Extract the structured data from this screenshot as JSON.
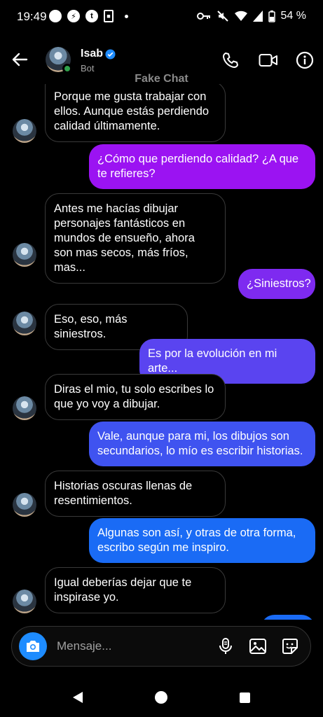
{
  "status_bar": {
    "time": "19:49",
    "battery": "54 %"
  },
  "header": {
    "back_icon": "arrow-left-icon",
    "name": "Isab",
    "subtitle": "Bot",
    "verified_icon": "verified-badge-icon",
    "call_icon": "phone-icon",
    "video_icon": "video-camera-icon",
    "info_icon": "info-icon"
  },
  "watermark": "Fake Chat",
  "messages": [
    {
      "from": "them",
      "text": "Porque me gusta trabajar con ellos. Aunque estás perdiendo calidad últimamente."
    },
    {
      "from": "me",
      "text": "¿Cómo que perdiendo calidad? ¿A que te refieres?"
    },
    {
      "from": "them",
      "text": "Antes me hacías dibujar personajes fantásticos en mundos de ensueño, ahora son mas secos, más fríos, mas..."
    },
    {
      "from": "me",
      "text": "¿Siniestros?"
    },
    {
      "from": "them",
      "text": "Eso, eso, más siniestros."
    },
    {
      "from": "me",
      "text": "Es por la evolución en mi arte..."
    },
    {
      "from": "them",
      "text": "Diras el mio, tu solo escribes lo que yo voy a dibujar."
    },
    {
      "from": "me",
      "text": "Vale, aunque para mi, los dibujos son secundarios, lo mío es escribir historias."
    },
    {
      "from": "them",
      "text": "Historias oscuras llenas de resentimientos."
    },
    {
      "from": "me",
      "text": "Algunas son así, y otras de otra forma, escribo según me inspiro."
    },
    {
      "from": "them",
      "text": "Igual deberías dejar que te inspirase yo."
    }
  ],
  "composer": {
    "placeholder": "Mensaje...",
    "camera_icon": "camera-icon",
    "mic_icon": "microphone-icon",
    "image_icon": "image-icon",
    "sticker_icon": "sticker-icon"
  },
  "colors": {
    "accent_purple": "#9b13f2",
    "accent_blue": "#1a6bf5",
    "incoming_border": "#3a3a3a",
    "online": "#31a24c"
  }
}
